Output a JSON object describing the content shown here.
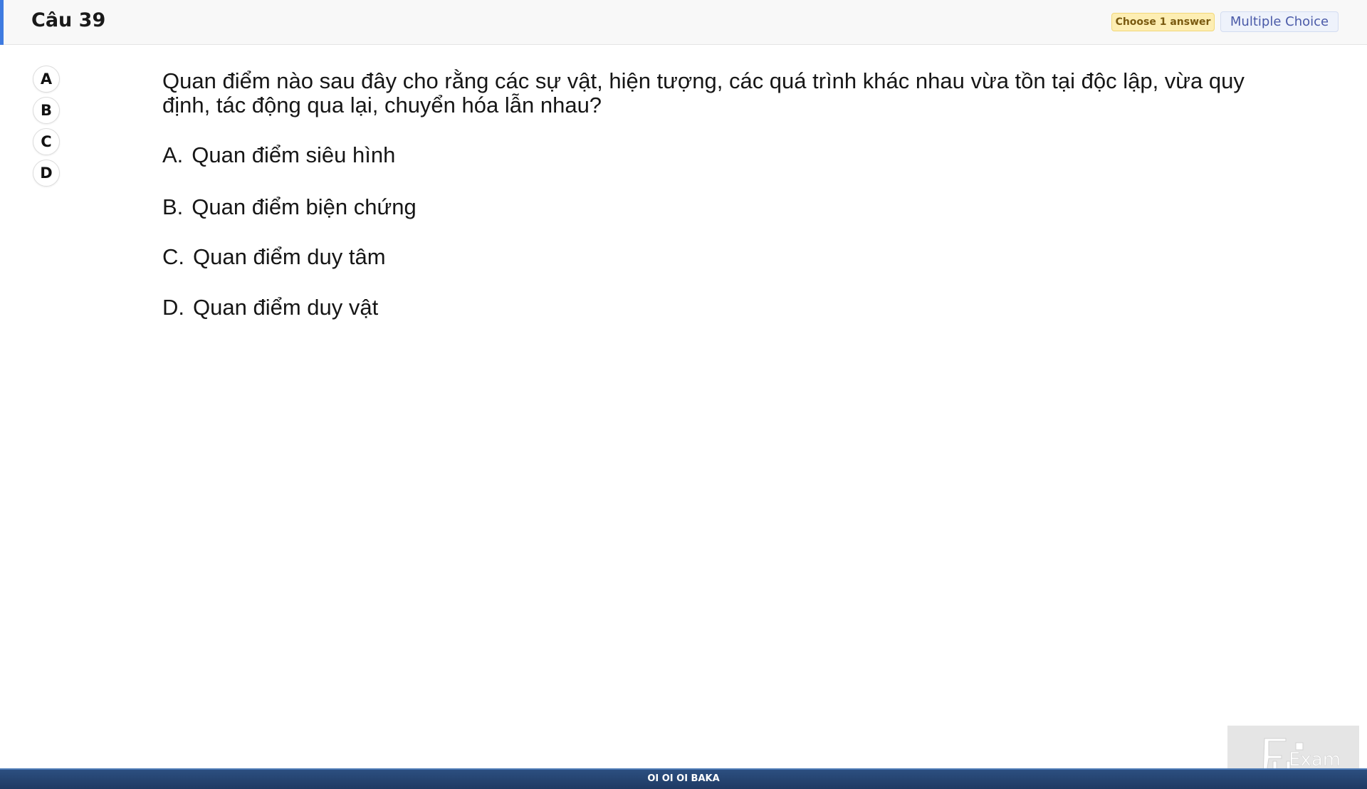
{
  "header": {
    "question_number": "Câu 39",
    "answer_hint": "Choose 1 answer",
    "question_type": "Multiple Choice",
    "accent_color": "#3f7be0"
  },
  "answer_selector": {
    "options": [
      "A",
      "B",
      "C",
      "D"
    ]
  },
  "question": {
    "text": "Quan điểm nào sau đây cho rằng các sự vật, hiện tượng, các quá trình khác nhau vừa tồn tại độc lập, vừa quy định, tác động qua lại, chuyển hóa lẫn nhau?",
    "options": [
      {
        "letter": "A.",
        "text": "Quan điểm siêu hình"
      },
      {
        "letter": "B.",
        "text": "Quan điểm biện chứng"
      },
      {
        "letter": "C.",
        "text": "Quan điểm duy tâm"
      },
      {
        "letter": "D.",
        "text": "Quan điểm duy vật"
      }
    ]
  },
  "logo": {
    "text": "Exam",
    "icon": "fu-exam-logo"
  },
  "footer": {
    "text": "OI OI OI BAKA",
    "color": "#1f3a63"
  }
}
